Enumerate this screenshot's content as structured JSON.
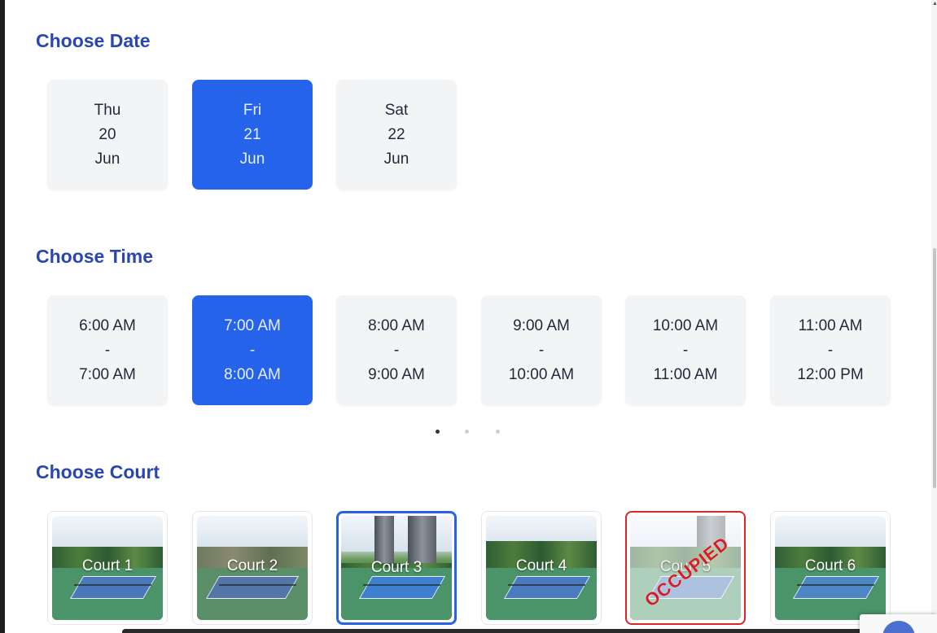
{
  "sections": {
    "date_title": "Choose Date",
    "time_title": "Choose Time",
    "court_title": "Choose Court"
  },
  "dates": [
    {
      "day": "Thu",
      "date": "20",
      "month": "Jun",
      "selected": false
    },
    {
      "day": "Fri",
      "date": "21",
      "month": "Jun",
      "selected": true
    },
    {
      "day": "Sat",
      "date": "22",
      "month": "Jun",
      "selected": false
    }
  ],
  "times": [
    {
      "start": "6:00 AM",
      "sep": "-",
      "end": "7:00 AM",
      "selected": false
    },
    {
      "start": "7:00 AM",
      "sep": "-",
      "end": "8:00 AM",
      "selected": true
    },
    {
      "start": "8:00 AM",
      "sep": "-",
      "end": "9:00 AM",
      "selected": false
    },
    {
      "start": "9:00 AM",
      "sep": "-",
      "end": "10:00 AM",
      "selected": false
    },
    {
      "start": "10:00 AM",
      "sep": "-",
      "end": "11:00 AM",
      "selected": false
    },
    {
      "start": "11:00 AM",
      "sep": "-",
      "end": "12:00 PM",
      "selected": false
    }
  ],
  "carousel": {
    "pages": 3,
    "active_page": 1
  },
  "courts": [
    {
      "label": "Court 1",
      "selected": false,
      "occupied": false
    },
    {
      "label": "Court 2",
      "selected": false,
      "occupied": false
    },
    {
      "label": "Court 3",
      "selected": true,
      "occupied": false
    },
    {
      "label": "Court 4",
      "selected": false,
      "occupied": false
    },
    {
      "label": "Court 5",
      "selected": false,
      "occupied": true,
      "stamp": "OCCUPIED"
    },
    {
      "label": "Court 6",
      "selected": false,
      "occupied": false
    }
  ],
  "colors": {
    "accent": "#2563eb",
    "heading": "#2a47b0",
    "card_bg": "#f3f4f6",
    "occupied": "#dc2626"
  }
}
